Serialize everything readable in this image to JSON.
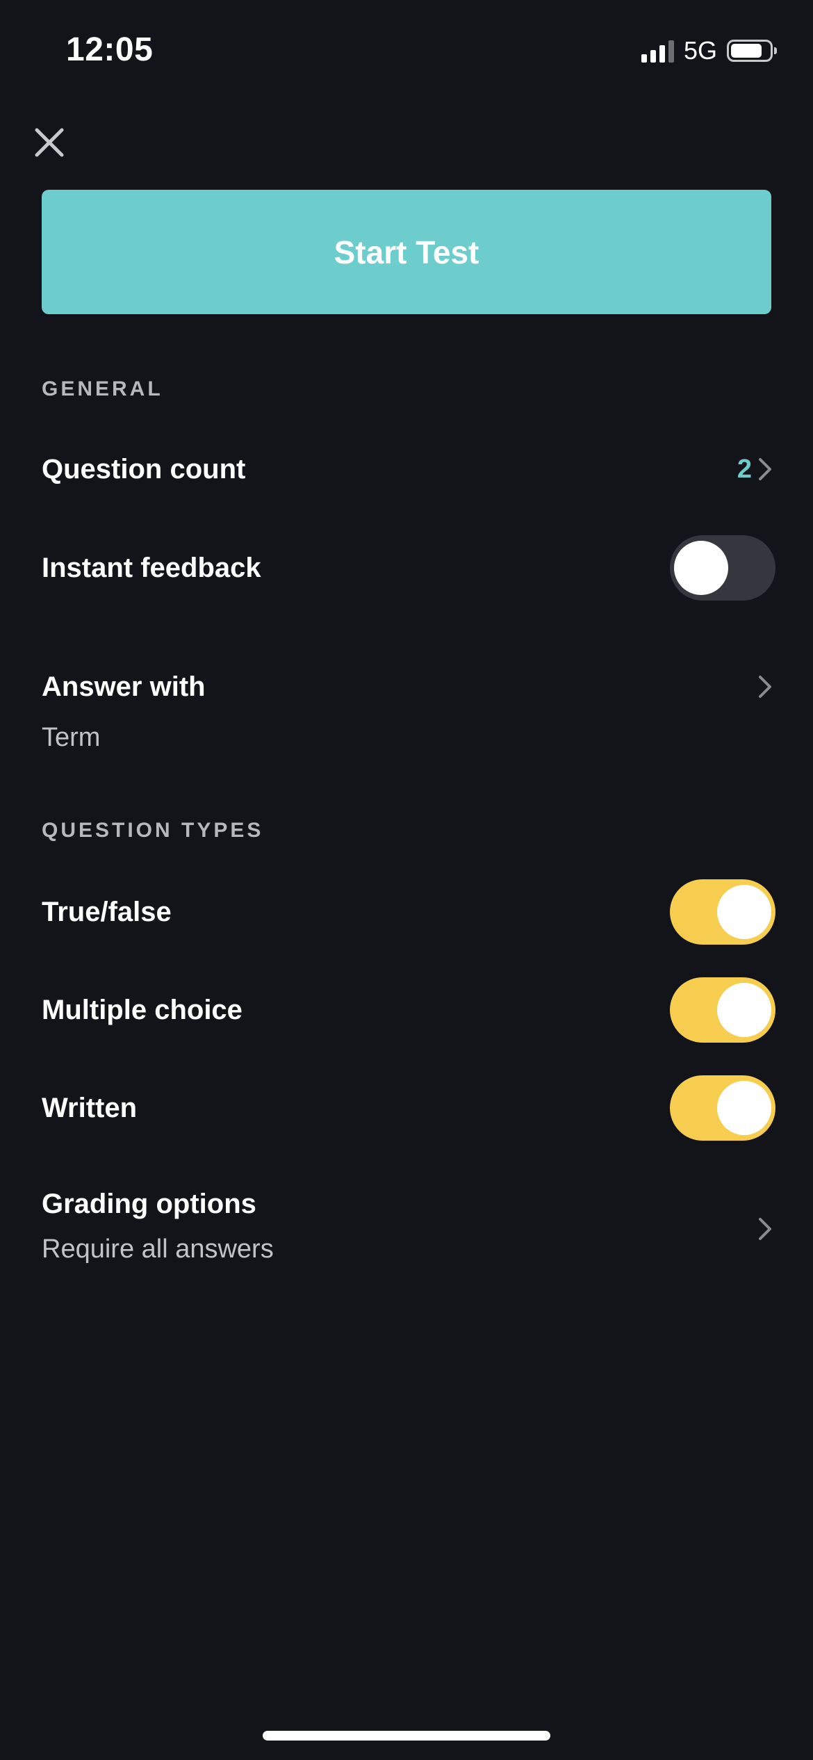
{
  "status_bar": {
    "time": "12:05",
    "network": "5G",
    "battery_level": 0.74
  },
  "header": {
    "close_icon": "close-icon"
  },
  "start_button": {
    "label": "Start Test",
    "color": "#6ccdcc"
  },
  "general": {
    "section_label": "GENERAL",
    "question_count": {
      "label": "Question count",
      "value": "2"
    },
    "instant_feedback": {
      "label": "Instant feedback",
      "enabled": false
    },
    "answer_with": {
      "label": "Answer with",
      "value": "Term"
    }
  },
  "question_types": {
    "section_label": "QUESTION TYPES",
    "items": [
      {
        "label": "True/false",
        "enabled": true
      },
      {
        "label": "Multiple choice",
        "enabled": true
      },
      {
        "label": "Written",
        "enabled": true
      }
    ]
  },
  "grading": {
    "label": "Grading options",
    "value": "Require all answers"
  },
  "colors": {
    "background": "#13141a",
    "accent_teal": "#6ccdcc",
    "toggle_on": "#f6cd4f",
    "toggle_off": "#36373e"
  }
}
